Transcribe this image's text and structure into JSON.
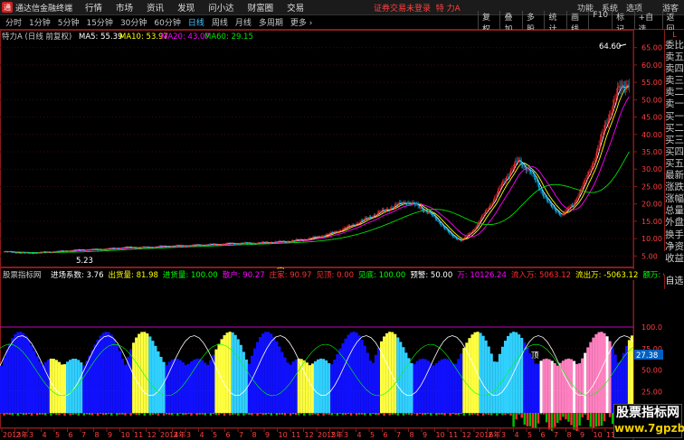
{
  "menubar": {
    "logo_char": "通",
    "app_name": "通达信金融终端",
    "items": [
      "行情",
      "市场",
      "资讯",
      "发现",
      "问小达",
      "财富圈",
      "交易"
    ],
    "login_status": "证券交易未登录",
    "stock_tag": "特 力A",
    "right_items": [
      "功能",
      "系统",
      "选项"
    ],
    "user": "游客"
  },
  "periods": {
    "items": [
      "分时",
      "1分钟",
      "5分钟",
      "15分钟",
      "30分钟",
      "60分钟",
      "日线",
      "周线",
      "月线",
      "多周期",
      "更多 ›"
    ],
    "active": "日线",
    "tools": [
      "复权",
      "叠加",
      "多股",
      "统计",
      "画线",
      "F10",
      "标记",
      "+自选",
      "返回"
    ]
  },
  "main_chart": {
    "title": "特力A (日线 前复权)",
    "ma": [
      {
        "label": "MA5: 55.39",
        "color": "#ffffff"
      },
      {
        "label": "MA10: 53.97",
        "color": "#ffff00"
      },
      {
        "label": "MA20: 43.07",
        "color": "#ff00ff"
      },
      {
        "label": "MA60: 29.15",
        "color": "#00e000"
      }
    ],
    "y_ticks": [
      "65.00",
      "60.00",
      "55.00",
      "50.00",
      "45.00",
      "40.00",
      "35.00",
      "30.00",
      "25.00",
      "20.00",
      "15.00",
      "10.00",
      "5.00"
    ],
    "high_label": "64.60",
    "low_label": "5.23",
    "mid_marker": "定"
  },
  "indicator": {
    "title": "股票指标网",
    "fields": [
      {
        "label": "进场系数: 3.76",
        "color": "#ffffff"
      },
      {
        "label": "出货量: 81.98",
        "color": "#ffff00"
      },
      {
        "label": "进货量: 100.00",
        "color": "#00ff00"
      },
      {
        "label": "散户: 90.27",
        "color": "#ff00ff"
      },
      {
        "label": "庄家: 90.97",
        "color": "#ff3030"
      },
      {
        "label": "见顶: 0.00",
        "color": "#ff3030"
      },
      {
        "label": "见底: 100.00",
        "color": "#00ff00"
      },
      {
        "label": "预警: 50.00",
        "color": "#ffffff"
      },
      {
        "label": "万: 10126.24",
        "color": "#ff00ff"
      },
      {
        "label": "流入万: 5063.12",
        "color": "#ff3030"
      },
      {
        "label": "流出万: -5063.12",
        "color": "#ffff00"
      },
      {
        "label": "额万: 0.00",
        "color": "#00ff00"
      },
      {
        "label": "分界: 0.00",
        "color": "#ffffff"
      }
    ],
    "y_ticks": [
      "100.0",
      "75.00",
      "50.00",
      "25.00",
      "0.00"
    ],
    "current_value": "27.38",
    "marker_text": "顶"
  },
  "time_axis": {
    "labels": [
      "2013年",
      "2",
      "3",
      "4",
      "5",
      "6",
      "7",
      "8",
      "9",
      "10",
      "11",
      "12",
      "2014年",
      "2",
      "3",
      "4",
      "5",
      "6",
      "7",
      "8",
      "9",
      "10",
      "11",
      "12",
      "2015年",
      "2",
      "3",
      "4",
      "5",
      "6",
      "7",
      "8",
      "9",
      "10",
      "11",
      "12",
      "2016年",
      "2",
      "3",
      "4",
      "5",
      "6",
      "7",
      "8",
      "9",
      "10",
      "11",
      "12"
    ]
  },
  "side_panel": {
    "top_label": "L",
    "items": [
      "委比",
      "卖五",
      "卖四",
      "卖三",
      "卖二",
      "卖一",
      "买一",
      "买二",
      "买三",
      "买四",
      "买五",
      "最新",
      "涨跌",
      "涨幅",
      "总量",
      "外盘",
      "换手",
      "净资",
      "收益"
    ],
    "button": "自选"
  },
  "watermark": {
    "line1": "股票指标网",
    "line2": "www.7gpzb.com"
  },
  "colors": {
    "up": "#ff3030",
    "down": "#00c0ff",
    "border": "#8b1a1a",
    "ma5": "#ffffff",
    "ma10": "#ffff00",
    "ma20": "#ff00ff",
    "ma60": "#00e000"
  },
  "chart_data": {
    "type": "candlestick",
    "ylim": [
      3,
      67
    ],
    "close": [
      6.2,
      6.05,
      5.82,
      5.95,
      6.1,
      6.3,
      6.55,
      6.75,
      6.8,
      6.95,
      7.2,
      7.45,
      7.4,
      7.5,
      7.7,
      7.85,
      7.9,
      8.05,
      8.2,
      8.3,
      8.5,
      8.65,
      8.6,
      8.75,
      8.95,
      9.1,
      9.4,
      9.8,
      10.4,
      11.2,
      12.3,
      13.6,
      15.0,
      16.6,
      18.0,
      19.4,
      20.6,
      19.5,
      17.6,
      14.8,
      11.0,
      9.4,
      12.4,
      17.0,
      22.0,
      27.8,
      32.4,
      30.0,
      24.5,
      19.2,
      16.8,
      20.0,
      26.0,
      34.0,
      44.0,
      52.5,
      55.39
    ]
  }
}
